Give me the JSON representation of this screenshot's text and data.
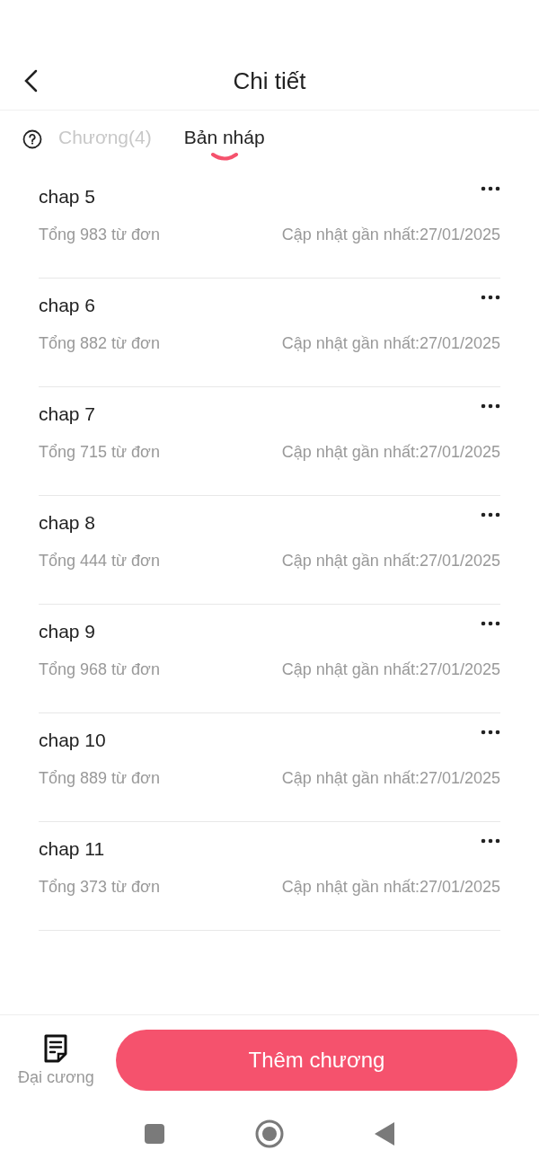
{
  "header": {
    "title": "Chi tiết"
  },
  "tabs": [
    {
      "label": "Chương(4)",
      "selected": false
    },
    {
      "label": "Bản nháp",
      "selected": true
    }
  ],
  "chapters": [
    {
      "title": "chap 5",
      "words": "Tổng 983 từ đơn",
      "updated": "Cập nhật gần nhất:27/01/2025"
    },
    {
      "title": "chap 6",
      "words": "Tổng 882 từ đơn",
      "updated": "Cập nhật gần nhất:27/01/2025"
    },
    {
      "title": "chap 7",
      "words": "Tổng 715 từ đơn",
      "updated": "Cập nhật gần nhất:27/01/2025"
    },
    {
      "title": "chap 8",
      "words": "Tổng 444 từ đơn",
      "updated": "Cập nhật gần nhất:27/01/2025"
    },
    {
      "title": "chap 9",
      "words": "Tổng 968 từ đơn",
      "updated": "Cập nhật gần nhất:27/01/2025"
    },
    {
      "title": "chap 10",
      "words": "Tổng 889 từ đơn",
      "updated": "Cập nhật gần nhất:27/01/2025"
    },
    {
      "title": "chap 11",
      "words": "Tổng 373 từ đơn",
      "updated": "Cập nhật gần nhất:27/01/2025"
    }
  ],
  "bottom_bar": {
    "outline_label": "Đại cương",
    "add_button": "Thêm chương"
  }
}
